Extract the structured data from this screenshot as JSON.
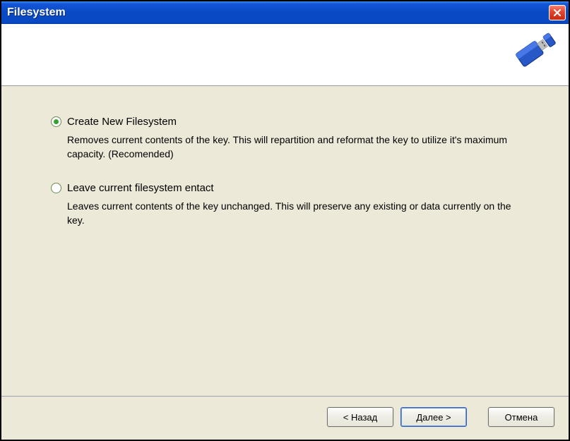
{
  "titlebar": {
    "title": "Filesystem"
  },
  "options": {
    "create": {
      "label": "Create New Filesystem",
      "description": "Removes current contents of the key.  This will repartition and reformat the key to utilize it's maximum capacity.  (Recomended)",
      "selected": true
    },
    "leave": {
      "label": "Leave current filesystem entact",
      "description": "Leaves current contents of the key unchanged.  This will preserve any existing or data currently on the key.",
      "selected": false
    }
  },
  "buttons": {
    "back": "< Назад",
    "next": "Далее >",
    "cancel": "Отмена"
  }
}
